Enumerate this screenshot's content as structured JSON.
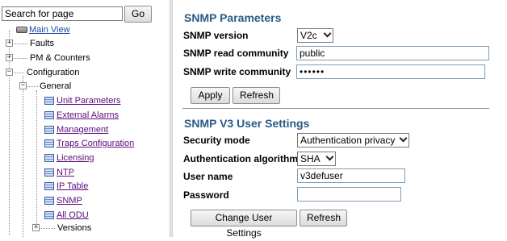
{
  "search": {
    "placeholder": "Search for page",
    "go_label": "Go"
  },
  "tree": {
    "main_view": "Main View",
    "faults": "Faults",
    "pm_counters": "PM & Counters",
    "configuration": "Configuration",
    "general": "General",
    "general_items": [
      "Unit Parameters",
      "External Alarms",
      "Management",
      "Traps Configuration",
      "Licensing",
      "NTP",
      "IP Table",
      "SNMP",
      "All ODU"
    ],
    "versions": "Versions"
  },
  "snmp": {
    "title": "SNMP Parameters",
    "version_label": "SNMP version",
    "version_value": "V2c",
    "read_label": "SNMP read community",
    "read_value": "public",
    "write_label": "SNMP write community",
    "write_value": "••••••",
    "apply_label": "Apply",
    "refresh_label": "Refresh"
  },
  "v3": {
    "title": "SNMP V3 User Settings",
    "security_label": "Security mode",
    "security_value": "Authentication privacy",
    "auth_label": "Authentication algorithm",
    "auth_value": "SHA",
    "user_label": "User name",
    "user_value": "v3defuser",
    "password_label": "Password",
    "password_value": "",
    "change_label": "Change User Settings",
    "refresh_label": "Refresh"
  }
}
